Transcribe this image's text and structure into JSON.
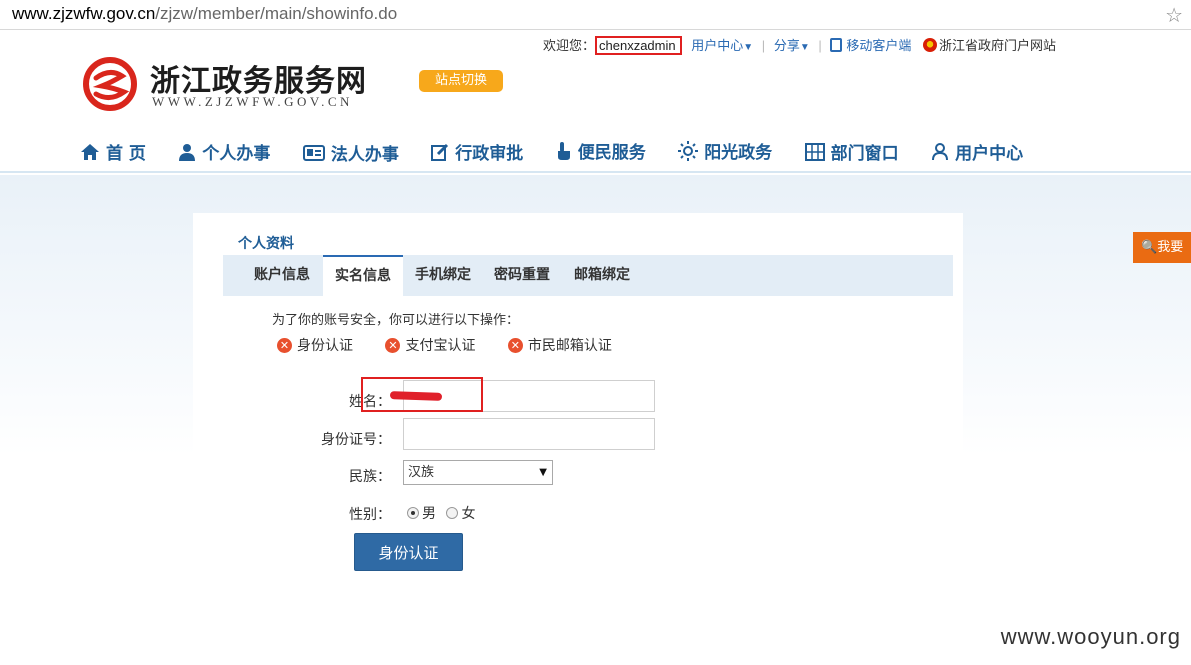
{
  "browser": {
    "url_host": "www.zjzwfw.gov.cn",
    "url_path": "/zjzw/member/main/showinfo.do"
  },
  "topbar": {
    "welcome": "欢迎您：",
    "username": "chenxzadmin",
    "user_center": "用户中心",
    "share": "分享",
    "mobile_client": "移动客户端",
    "portal": "浙江省政府门户网站"
  },
  "logo": {
    "title": "浙江政务服务网",
    "subtitle": "WWW.ZJZWFW.GOV.CN"
  },
  "switch_site": "站点切换",
  "nav": [
    {
      "label": "首 页",
      "icon": "home-icon"
    },
    {
      "label": "个人办事",
      "icon": "person-icon"
    },
    {
      "label": "法人办事",
      "icon": "id-card-icon"
    },
    {
      "label": "行政审批",
      "icon": "edit-icon"
    },
    {
      "label": "便民服务",
      "icon": "hand-icon"
    },
    {
      "label": "阳光政务",
      "icon": "sun-icon"
    },
    {
      "label": "部门窗口",
      "icon": "grid-icon"
    },
    {
      "label": "用户中心",
      "icon": "user-icon"
    }
  ],
  "panel": {
    "title": "个人资料",
    "tabs": [
      "账户信息",
      "实名信息",
      "手机绑定",
      "密码重置",
      "邮箱绑定"
    ],
    "active_tab": "实名信息",
    "notice": "为了你的账号安全，你可以进行以下操作：",
    "verifications": [
      "身份认证",
      "支付宝认证",
      "市民邮箱认证"
    ]
  },
  "form": {
    "name_label": "姓名：",
    "id_label": "身份证号：",
    "id_value": "",
    "ethnicity_label": "民族：",
    "ethnicity_value": "汉族",
    "gender_label": "性别：",
    "gender_options": [
      "男",
      "女"
    ],
    "gender_selected": "男",
    "submit": "身份认证"
  },
  "float_button": "我要",
  "watermark": "www.wooyun.org",
  "colors": {
    "accent": "#2f6aa5",
    "nav_text": "#1f5d96",
    "switch": "#f7a81b",
    "highlight": "#e02020",
    "float": "#ea6b12"
  }
}
